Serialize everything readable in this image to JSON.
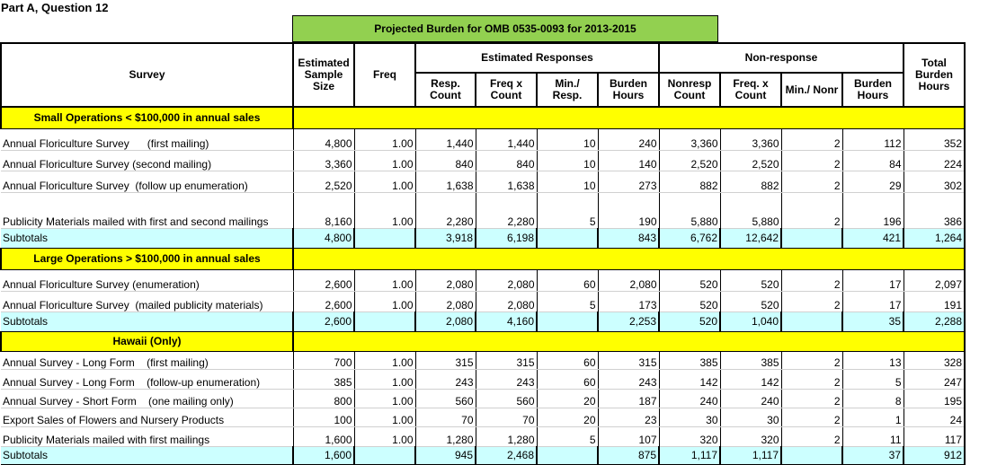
{
  "part_label": "Part A, Question 12",
  "title": "Projected Burden for OMB 0535-0093 for 2013-2015",
  "headers": {
    "survey": "Survey",
    "sample_size": "Estimated Sample Size",
    "freq": "Freq",
    "est_responses": "Estimated Responses",
    "non_response": "Non-response",
    "total_burden": "Total Burden Hours",
    "resp_count": "Resp. Count",
    "freq_x_count": "Freq x Count",
    "min_resp": "Min./ Resp.",
    "burden_hours": "Burden Hours",
    "nonresp_count": "Nonresp Count",
    "freq_x_count2": "Freq. x Count",
    "min_nonr": "Min./ Nonr",
    "burden_hours2": "Burden Hours"
  },
  "sections": [
    {
      "label": "Small Operations < $100,000 in annual sales",
      "rows": [
        {
          "survey": "Annual Floriculture Survey      (first mailing)",
          "size": "4,800",
          "freq": "1.00",
          "resp": "1,440",
          "fxc": "1,440",
          "min": "10",
          "bh": "240",
          "nr": "3,360",
          "nfxc": "3,360",
          "nmin": "2",
          "nbh": "112",
          "total": "352"
        },
        {
          "survey": "Annual Floriculture Survey (second mailing)",
          "size": "3,360",
          "freq": "1.00",
          "resp": "840",
          "fxc": "840",
          "min": "10",
          "bh": "140",
          "nr": "2,520",
          "nfxc": "2,520",
          "nmin": "2",
          "nbh": "84",
          "total": "224"
        },
        {
          "survey": "Annual Floriculture Survey  (follow up enumeration)",
          "size": "2,520",
          "freq": "1.00",
          "resp": "1,638",
          "fxc": "1,638",
          "min": "10",
          "bh": "273",
          "nr": "882",
          "nfxc": "882",
          "nmin": "2",
          "nbh": "29",
          "total": "302"
        },
        {
          "survey": "Publicity Materials mailed with first and second mailings",
          "size": "8,160",
          "freq": "1.00",
          "resp": "2,280",
          "fxc": "2,280",
          "min": "5",
          "bh": "190",
          "nr": "5,880",
          "nfxc": "5,880",
          "nmin": "2",
          "nbh": "196",
          "total": "386"
        }
      ],
      "subtotal": {
        "label": "Subtotals",
        "size": "4,800",
        "resp": "3,918",
        "fxc": "6,198",
        "bh": "843",
        "nr": "6,762",
        "nfxc": "12,642",
        "nbh": "421",
        "total": "1,264"
      }
    },
    {
      "label": "Large Operations > $100,000 in annual sales",
      "rows": [
        {
          "survey": "Annual Floriculture Survey (enumeration)",
          "size": "2,600",
          "freq": "1.00",
          "resp": "2,080",
          "fxc": "2,080",
          "min": "60",
          "bh": "2,080",
          "nr": "520",
          "nfxc": "520",
          "nmin": "2",
          "nbh": "17",
          "total": "2,097"
        },
        {
          "survey": "Annual Floriculture Survey  (mailed publicity materials)",
          "size": "2,600",
          "freq": "1.00",
          "resp": "2,080",
          "fxc": "2,080",
          "min": "5",
          "bh": "173",
          "nr": "520",
          "nfxc": "520",
          "nmin": "2",
          "nbh": "17",
          "total": "191"
        }
      ],
      "subtotal": {
        "label": "Subtotals",
        "size": "2,600",
        "resp": "2,080",
        "fxc": "4,160",
        "bh": "2,253",
        "nr": "520",
        "nfxc": "1,040",
        "nbh": "35",
        "total": "2,288"
      }
    },
    {
      "label": "Hawaii (Only)",
      "rows": [
        {
          "survey": "Annual Survey - Long Form    (first mailing)",
          "size": "700",
          "freq": "1.00",
          "resp": "315",
          "fxc": "315",
          "min": "60",
          "bh": "315",
          "nr": "385",
          "nfxc": "385",
          "nmin": "2",
          "nbh": "13",
          "total": "328"
        },
        {
          "survey": "Annual Survey - Long Form    (follow-up enumeration)",
          "size": "385",
          "freq": "1.00",
          "resp": "243",
          "fxc": "243",
          "min": "60",
          "bh": "243",
          "nr": "142",
          "nfxc": "142",
          "nmin": "2",
          "nbh": "5",
          "total": "247"
        },
        {
          "survey": "Annual Survey - Short Form    (one mailing only)",
          "size": "800",
          "freq": "1.00",
          "resp": "560",
          "fxc": "560",
          "min": "20",
          "bh": "187",
          "nr": "240",
          "nfxc": "240",
          "nmin": "2",
          "nbh": "8",
          "total": "195"
        },
        {
          "survey": "Export Sales of Flowers and Nursery Products",
          "size": "100",
          "freq": "1.00",
          "resp": "70",
          "fxc": "70",
          "min": "20",
          "bh": "23",
          "nr": "30",
          "nfxc": "30",
          "nmin": "2",
          "nbh": "1",
          "total": "24"
        },
        {
          "survey": "Publicity Materials mailed with first mailings",
          "size": "1,600",
          "freq": "1.00",
          "resp": "1,280",
          "fxc": "1,280",
          "min": "5",
          "bh": "107",
          "nr": "320",
          "nfxc": "320",
          "nmin": "2",
          "nbh": "11",
          "total": "117"
        }
      ],
      "subtotal": {
        "label": "Subtotals",
        "size": "1,600",
        "resp": "945",
        "fxc": "2,468",
        "bh": "875",
        "nr": "1,117",
        "nfxc": "1,117",
        "nbh": "37",
        "total": "912"
      }
    }
  ]
}
